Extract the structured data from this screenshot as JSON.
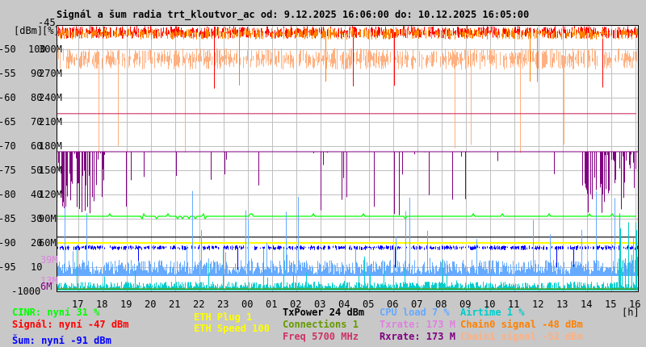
{
  "chart_data": {
    "type": "line",
    "title": "Signál a šum radia trt_kloutvor_ac od: 9.12.2025 16:06:00 do: 10.12.2025 16:05:00",
    "axis_header": {
      "dbm": "[dBm]",
      "pct": "[%]"
    },
    "xlabel": "[h]",
    "x_ticks": [
      "17",
      "18",
      "19",
      "20",
      "21",
      "22",
      "23",
      "00",
      "01",
      "02",
      "03",
      "04",
      "05",
      "06",
      "07",
      "08",
      "09",
      "10",
      "11",
      "12",
      "13",
      "14",
      "15",
      "16"
    ],
    "y_dbm_ticks": [
      "-45",
      "-50",
      "-55",
      "-60",
      "-65",
      "-70",
      "-75",
      "-80",
      "-85",
      "-90",
      "-95",
      "-100"
    ],
    "y_pct_ticks": [
      "100",
      "90",
      "80",
      "70",
      "60",
      "50",
      "40",
      "30",
      "20",
      "10",
      "0"
    ],
    "y_rate_ticks": [
      "300M",
      "270M",
      "240M",
      "210M",
      "180M",
      "150M",
      "120M",
      "90M",
      "60M"
    ],
    "y_rate_extra_ticks": [
      {
        "label": "39M",
        "color": "#e080e0"
      },
      {
        "label": "13M",
        "color": "#e080e0"
      },
      {
        "label": "6M",
        "color": "#800080"
      }
    ],
    "ylim_dbm": [
      -100,
      -45
    ],
    "ylim_pct": [
      0,
      110
    ],
    "grid": true,
    "series": [
      {
        "name": "Chain1 signal",
        "axis": "dbm",
        "base": -52,
        "noise": 2.2,
        "color": "#ffb080",
        "mode": "band"
      },
      {
        "name": "Signal",
        "axis": "dbm",
        "base": -46.5,
        "noise": 1.3,
        "color": "#ff0000",
        "mode": "band"
      },
      {
        "name": "Chain0 signal",
        "axis": "dbm",
        "base": -46.8,
        "noise": 1.2,
        "color": "#ff8000",
        "mode": "band"
      },
      {
        "name": "Freq",
        "axis": "dbm",
        "base": -63.3,
        "noise": 0,
        "color": "#cc3366",
        "mode": "line"
      },
      {
        "name": "Rxrate",
        "axis": "rate",
        "base": 173,
        "noise": 40,
        "color": "#800080",
        "mode": "down"
      },
      {
        "name": "TxPower",
        "axis": "dbm",
        "base": -88.8,
        "noise": 0,
        "color": "#000000",
        "mode": "line"
      },
      {
        "name": "CINR",
        "axis": "pct",
        "base": 31,
        "noise": 1,
        "color": "#00ff00",
        "mode": "line"
      },
      {
        "name": "ETH Speed",
        "axis": "pct",
        "base": 20,
        "noise": 0,
        "color": "#ffff00",
        "mode": "line"
      },
      {
        "name": "Noise",
        "axis": "dbm",
        "base": -91,
        "noise": 0.5,
        "color": "#0000ff",
        "mode": "band"
      },
      {
        "name": "CPU load",
        "axis": "pct",
        "base": 7,
        "noise": 6,
        "color": "#66aaff",
        "mode": "up"
      },
      {
        "name": "Airtime",
        "axis": "pct",
        "base": 1,
        "noise": 3,
        "color": "#00cccc",
        "mode": "up"
      },
      {
        "name": "Connections",
        "axis": "pct",
        "base": 1,
        "noise": 0,
        "color": "#669900",
        "mode": "line"
      }
    ]
  },
  "legend": [
    {
      "label": "CINR: nyní 31 %",
      "color": "#00ff00"
    },
    {
      "label": "Signál: nyní -47 dBm",
      "color": "#ff0000"
    },
    {
      "label": "Šum: nyní -91 dBm",
      "color": "#0000ff"
    },
    {
      "label": "ETH Plug 1",
      "color": "#ffff00"
    },
    {
      "label": "ETH Speed 100",
      "color": "#ffff00"
    },
    {
      "label": "TxPower 24 dBm",
      "color": "#000000"
    },
    {
      "label": "Connections 1",
      "color": "#669900"
    },
    {
      "label": "Freq 5700 MHz",
      "color": "#cc3366"
    },
    {
      "label": "CPU load 7 %",
      "color": "#66aaff"
    },
    {
      "label": "Txrate: 173 M",
      "color": "#e080e0"
    },
    {
      "label": "Rxrate: 173 M",
      "color": "#800080"
    },
    {
      "label": "Airtime 1 %",
      "color": "#00cccc"
    },
    {
      "label": "Chain0 signal -48 dBm",
      "color": "#ff8000"
    },
    {
      "label": "Chain1 signal -52 dBm",
      "color": "#ffb080"
    }
  ]
}
